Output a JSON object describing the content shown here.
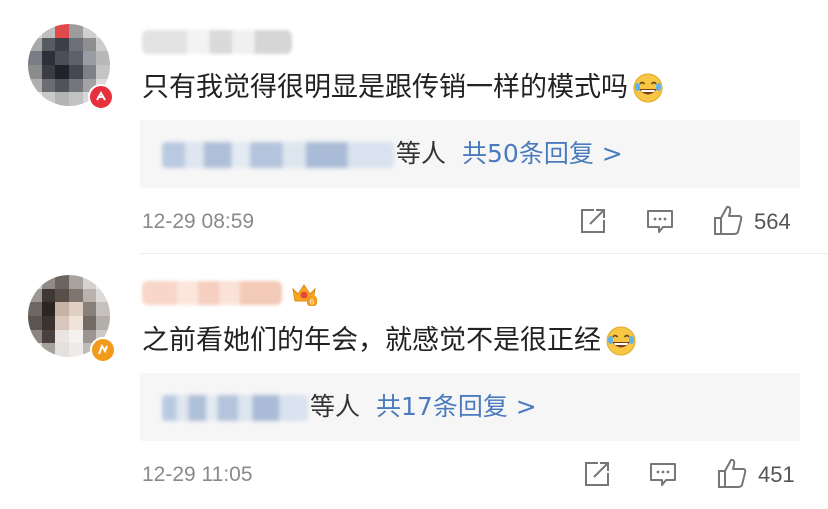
{
  "comments": [
    {
      "text": "只有我觉得很明显是跟传销一样的模式吗",
      "reply_suffix": "等人",
      "reply_link": "共50条回复 >",
      "time": "12-29 08:59",
      "likes": "564",
      "icons": [
        "avatar",
        "verified-badge-icon",
        "laugh-emoji-icon",
        "share-icon",
        "comment-icon",
        "like-icon"
      ]
    },
    {
      "text": "之前看她们的年会，就感觉不是很正经",
      "reply_suffix": "等人",
      "reply_link": "共17条回复 >",
      "time": "12-29 11:05",
      "likes": "451",
      "icons": [
        "avatar",
        "verified-badge-icon",
        "vip-crown-icon",
        "laugh-emoji-icon",
        "share-icon",
        "comment-icon",
        "like-icon"
      ]
    }
  ],
  "colors": {
    "link": "#4b7bbd",
    "meta": "#8a8a8a",
    "reply_bg": "#f6f6f6"
  }
}
